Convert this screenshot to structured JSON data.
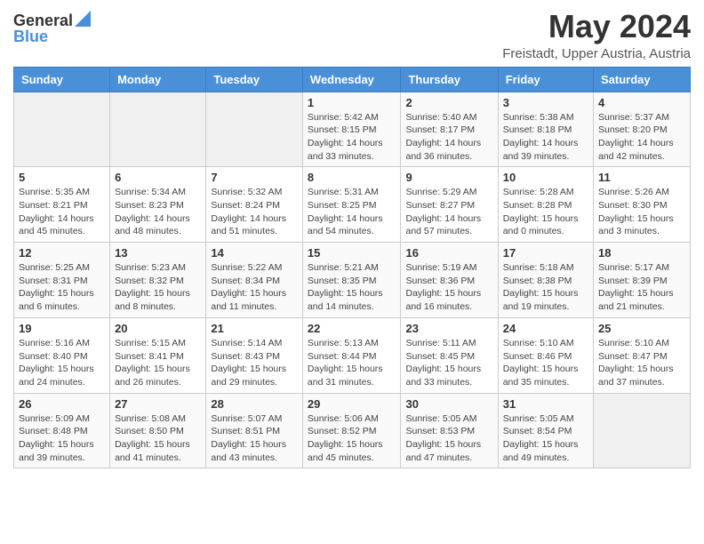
{
  "logo": {
    "line1": "General",
    "line2": "Blue"
  },
  "title": "May 2024",
  "location": "Freistadt, Upper Austria, Austria",
  "weekdays": [
    "Sunday",
    "Monday",
    "Tuesday",
    "Wednesday",
    "Thursday",
    "Friday",
    "Saturday"
  ],
  "weeks": [
    [
      {
        "day": "",
        "sunrise": "",
        "sunset": "",
        "daylight": ""
      },
      {
        "day": "",
        "sunrise": "",
        "sunset": "",
        "daylight": ""
      },
      {
        "day": "",
        "sunrise": "",
        "sunset": "",
        "daylight": ""
      },
      {
        "day": "1",
        "sunrise": "Sunrise: 5:42 AM",
        "sunset": "Sunset: 8:15 PM",
        "daylight": "Daylight: 14 hours and 33 minutes."
      },
      {
        "day": "2",
        "sunrise": "Sunrise: 5:40 AM",
        "sunset": "Sunset: 8:17 PM",
        "daylight": "Daylight: 14 hours and 36 minutes."
      },
      {
        "day": "3",
        "sunrise": "Sunrise: 5:38 AM",
        "sunset": "Sunset: 8:18 PM",
        "daylight": "Daylight: 14 hours and 39 minutes."
      },
      {
        "day": "4",
        "sunrise": "Sunrise: 5:37 AM",
        "sunset": "Sunset: 8:20 PM",
        "daylight": "Daylight: 14 hours and 42 minutes."
      }
    ],
    [
      {
        "day": "5",
        "sunrise": "Sunrise: 5:35 AM",
        "sunset": "Sunset: 8:21 PM",
        "daylight": "Daylight: 14 hours and 45 minutes."
      },
      {
        "day": "6",
        "sunrise": "Sunrise: 5:34 AM",
        "sunset": "Sunset: 8:23 PM",
        "daylight": "Daylight: 14 hours and 48 minutes."
      },
      {
        "day": "7",
        "sunrise": "Sunrise: 5:32 AM",
        "sunset": "Sunset: 8:24 PM",
        "daylight": "Daylight: 14 hours and 51 minutes."
      },
      {
        "day": "8",
        "sunrise": "Sunrise: 5:31 AM",
        "sunset": "Sunset: 8:25 PM",
        "daylight": "Daylight: 14 hours and 54 minutes."
      },
      {
        "day": "9",
        "sunrise": "Sunrise: 5:29 AM",
        "sunset": "Sunset: 8:27 PM",
        "daylight": "Daylight: 14 hours and 57 minutes."
      },
      {
        "day": "10",
        "sunrise": "Sunrise: 5:28 AM",
        "sunset": "Sunset: 8:28 PM",
        "daylight": "Daylight: 15 hours and 0 minutes."
      },
      {
        "day": "11",
        "sunrise": "Sunrise: 5:26 AM",
        "sunset": "Sunset: 8:30 PM",
        "daylight": "Daylight: 15 hours and 3 minutes."
      }
    ],
    [
      {
        "day": "12",
        "sunrise": "Sunrise: 5:25 AM",
        "sunset": "Sunset: 8:31 PM",
        "daylight": "Daylight: 15 hours and 6 minutes."
      },
      {
        "day": "13",
        "sunrise": "Sunrise: 5:23 AM",
        "sunset": "Sunset: 8:32 PM",
        "daylight": "Daylight: 15 hours and 8 minutes."
      },
      {
        "day": "14",
        "sunrise": "Sunrise: 5:22 AM",
        "sunset": "Sunset: 8:34 PM",
        "daylight": "Daylight: 15 hours and 11 minutes."
      },
      {
        "day": "15",
        "sunrise": "Sunrise: 5:21 AM",
        "sunset": "Sunset: 8:35 PM",
        "daylight": "Daylight: 15 hours and 14 minutes."
      },
      {
        "day": "16",
        "sunrise": "Sunrise: 5:19 AM",
        "sunset": "Sunset: 8:36 PM",
        "daylight": "Daylight: 15 hours and 16 minutes."
      },
      {
        "day": "17",
        "sunrise": "Sunrise: 5:18 AM",
        "sunset": "Sunset: 8:38 PM",
        "daylight": "Daylight: 15 hours and 19 minutes."
      },
      {
        "day": "18",
        "sunrise": "Sunrise: 5:17 AM",
        "sunset": "Sunset: 8:39 PM",
        "daylight": "Daylight: 15 hours and 21 minutes."
      }
    ],
    [
      {
        "day": "19",
        "sunrise": "Sunrise: 5:16 AM",
        "sunset": "Sunset: 8:40 PM",
        "daylight": "Daylight: 15 hours and 24 minutes."
      },
      {
        "day": "20",
        "sunrise": "Sunrise: 5:15 AM",
        "sunset": "Sunset: 8:41 PM",
        "daylight": "Daylight: 15 hours and 26 minutes."
      },
      {
        "day": "21",
        "sunrise": "Sunrise: 5:14 AM",
        "sunset": "Sunset: 8:43 PM",
        "daylight": "Daylight: 15 hours and 29 minutes."
      },
      {
        "day": "22",
        "sunrise": "Sunrise: 5:13 AM",
        "sunset": "Sunset: 8:44 PM",
        "daylight": "Daylight: 15 hours and 31 minutes."
      },
      {
        "day": "23",
        "sunrise": "Sunrise: 5:11 AM",
        "sunset": "Sunset: 8:45 PM",
        "daylight": "Daylight: 15 hours and 33 minutes."
      },
      {
        "day": "24",
        "sunrise": "Sunrise: 5:10 AM",
        "sunset": "Sunset: 8:46 PM",
        "daylight": "Daylight: 15 hours and 35 minutes."
      },
      {
        "day": "25",
        "sunrise": "Sunrise: 5:10 AM",
        "sunset": "Sunset: 8:47 PM",
        "daylight": "Daylight: 15 hours and 37 minutes."
      }
    ],
    [
      {
        "day": "26",
        "sunrise": "Sunrise: 5:09 AM",
        "sunset": "Sunset: 8:48 PM",
        "daylight": "Daylight: 15 hours and 39 minutes."
      },
      {
        "day": "27",
        "sunrise": "Sunrise: 5:08 AM",
        "sunset": "Sunset: 8:50 PM",
        "daylight": "Daylight: 15 hours and 41 minutes."
      },
      {
        "day": "28",
        "sunrise": "Sunrise: 5:07 AM",
        "sunset": "Sunset: 8:51 PM",
        "daylight": "Daylight: 15 hours and 43 minutes."
      },
      {
        "day": "29",
        "sunrise": "Sunrise: 5:06 AM",
        "sunset": "Sunset: 8:52 PM",
        "daylight": "Daylight: 15 hours and 45 minutes."
      },
      {
        "day": "30",
        "sunrise": "Sunrise: 5:05 AM",
        "sunset": "Sunset: 8:53 PM",
        "daylight": "Daylight: 15 hours and 47 minutes."
      },
      {
        "day": "31",
        "sunrise": "Sunrise: 5:05 AM",
        "sunset": "Sunset: 8:54 PM",
        "daylight": "Daylight: 15 hours and 49 minutes."
      },
      {
        "day": "",
        "sunrise": "",
        "sunset": "",
        "daylight": ""
      }
    ]
  ]
}
